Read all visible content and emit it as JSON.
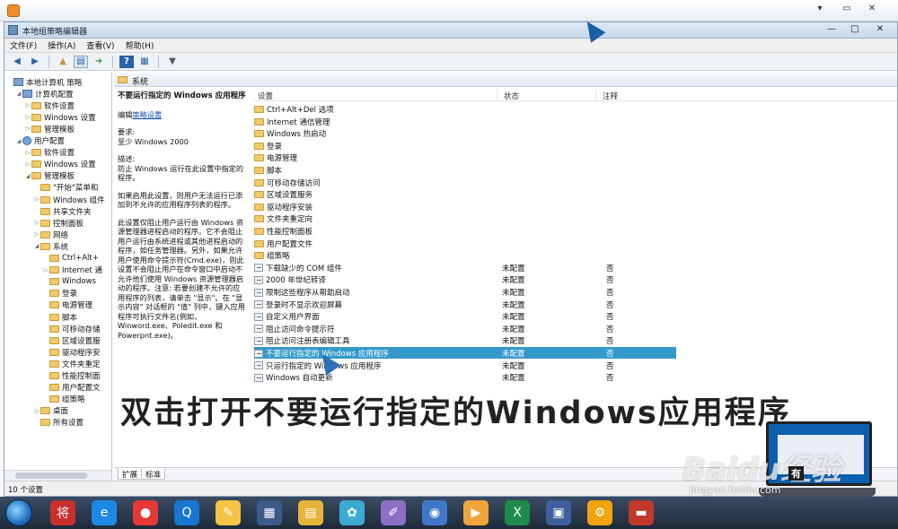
{
  "window": {
    "title": "本地组策略编辑器",
    "controls": [
      "—",
      "□",
      "✕"
    ]
  },
  "menu": [
    "文件(F)",
    "操作(A)",
    "查看(V)",
    "帮助(H)"
  ],
  "toolbar_icons": [
    "back-arrow-icon",
    "forward-arrow-icon",
    "up-folder-icon",
    "show-tree-icon",
    "export-list-icon",
    "help-icon",
    "properties-icon",
    "filter-icon"
  ],
  "tree": [
    {
      "label": "本地计算机 策略",
      "level": 0,
      "icon": "pc",
      "toggle": ""
    },
    {
      "label": "计算机配置",
      "level": 1,
      "icon": "pc",
      "toggle": "◢"
    },
    {
      "label": "软件设置",
      "level": 2,
      "icon": "fold",
      "toggle": "▷"
    },
    {
      "label": "Windows 设置",
      "level": 2,
      "icon": "fold",
      "toggle": "▷"
    },
    {
      "label": "管理模板",
      "level": 2,
      "icon": "fold",
      "toggle": "▷"
    },
    {
      "label": "用户配置",
      "level": 1,
      "icon": "usr",
      "toggle": "◢"
    },
    {
      "label": "软件设置",
      "level": 2,
      "icon": "fold",
      "toggle": "▷"
    },
    {
      "label": "Windows 设置",
      "level": 2,
      "icon": "fold",
      "toggle": "▷"
    },
    {
      "label": "管理模板",
      "level": 2,
      "icon": "fold",
      "toggle": "◢"
    },
    {
      "label": "\"开始\"菜单和",
      "level": 3,
      "icon": "fold",
      "toggle": ""
    },
    {
      "label": "Windows 组件",
      "level": 3,
      "icon": "fold",
      "toggle": "▷"
    },
    {
      "label": "共享文件夹",
      "level": 3,
      "icon": "fold",
      "toggle": ""
    },
    {
      "label": "控制面板",
      "level": 3,
      "icon": "fold",
      "toggle": "▷"
    },
    {
      "label": "网络",
      "level": 3,
      "icon": "fold",
      "toggle": "▷"
    },
    {
      "label": "系统",
      "level": 3,
      "icon": "fold",
      "toggle": "◢"
    },
    {
      "label": "Ctrl+Alt+",
      "level": 4,
      "icon": "fold",
      "toggle": ""
    },
    {
      "label": "Internet 通",
      "level": 4,
      "icon": "fold",
      "toggle": "▷"
    },
    {
      "label": "Windows",
      "level": 4,
      "icon": "fold",
      "toggle": ""
    },
    {
      "label": "登录",
      "level": 4,
      "icon": "fold",
      "toggle": ""
    },
    {
      "label": "电源管理",
      "level": 4,
      "icon": "fold",
      "toggle": ""
    },
    {
      "label": "脚本",
      "level": 4,
      "icon": "fold",
      "toggle": ""
    },
    {
      "label": "可移动存储",
      "level": 4,
      "icon": "fold",
      "toggle": ""
    },
    {
      "label": "区域设置服",
      "level": 4,
      "icon": "fold",
      "toggle": ""
    },
    {
      "label": "驱动程序安",
      "level": 4,
      "icon": "fold",
      "toggle": ""
    },
    {
      "label": "文件夹重定",
      "level": 4,
      "icon": "fold",
      "toggle": ""
    },
    {
      "label": "性能控制面",
      "level": 4,
      "icon": "fold",
      "toggle": ""
    },
    {
      "label": "用户配置文",
      "level": 4,
      "icon": "fold",
      "toggle": ""
    },
    {
      "label": "组策略",
      "level": 4,
      "icon": "fold",
      "toggle": ""
    },
    {
      "label": "桌面",
      "level": 3,
      "icon": "fold",
      "toggle": "▷"
    },
    {
      "label": "所有设置",
      "level": 3,
      "icon": "fold",
      "toggle": ""
    }
  ],
  "content_header": "系统",
  "description": {
    "title": "不要运行指定的 Windows 应用程序",
    "edit_prefix": "编辑",
    "edit_link": "策略设置",
    "req_label": "要求:",
    "req_value": "至少 Windows 2000",
    "desc_label": "描述:",
    "desc_1": "防止 Windows 运行在此设置中指定的程序。",
    "desc_2": "如果启用此设置，则用户无法运行已添加到不允许的应用程序列表的程序。",
    "desc_3": "此设置仅阻止用户运行由 Windows 资源管理器进程启动的程序。它不会阻止用户运行由系统进程或其他进程启动的程序，如任务管理器。另外，如果允许用户使用命令提示符(Cmd.exe)，则此设置不会阻止用户在命令窗口中启动不允许他们使用 Windows 资源管理器启动的程序。注意: 若要创建不允许的应用程序的列表，请单击 \"显示\"。在 \"显示内容\" 对话框的 \"值\" 列中，键入应用程序可执行文件名(例如，Winword.exe、Poledit.exe 和 Powerpnt.exe)。"
  },
  "columns": {
    "setting": "设置",
    "state": "状态",
    "comment": "注释"
  },
  "folders": [
    "Ctrl+Alt+Del 选项",
    "Internet 通信管理",
    "Windows 热启动",
    "登录",
    "电源管理",
    "脚本",
    "可移动存储访问",
    "区域设置服务",
    "驱动程序安装",
    "文件夹重定向",
    "性能控制面板",
    "用户配置文件",
    "组策略"
  ],
  "policies": [
    {
      "name": "下载缺少的 COM 组件",
      "state": "未配置",
      "comment": "否",
      "selected": false
    },
    {
      "name": "2000 年世纪转译",
      "state": "未配置",
      "comment": "否",
      "selected": false
    },
    {
      "name": "限制这些程序从帮助启动",
      "state": "未配置",
      "comment": "否",
      "selected": false
    },
    {
      "name": "登录时不显示欢迎屏幕",
      "state": "未配置",
      "comment": "否",
      "selected": false
    },
    {
      "name": "自定义用户界面",
      "state": "未配置",
      "comment": "否",
      "selected": false
    },
    {
      "name": "阻止访问命令提示符",
      "state": "未配置",
      "comment": "否",
      "selected": false
    },
    {
      "name": "阻止访问注册表编辑工具",
      "state": "未配置",
      "comment": "否",
      "selected": false
    },
    {
      "name": "不要运行指定的 Windows 应用程序",
      "state": "未配置",
      "comment": "否",
      "selected": true
    },
    {
      "name": "只运行指定的 Windows 应用程序",
      "state": "未配置",
      "comment": "否",
      "selected": false
    },
    {
      "name": "Windows 自动更新",
      "state": "未配置",
      "comment": "否",
      "selected": false
    }
  ],
  "tabs": [
    "扩展",
    "标准"
  ],
  "status": "10 个设置",
  "caption": "双击打开不要运行指定的Windows应用程序",
  "watermark": {
    "brand": "Baidu经验",
    "sub": "有",
    "url": "jingyan.baidu.com"
  },
  "taskbar": {
    "icons": [
      "start-orb-icon",
      "将-app-icon",
      "ie-browser-icon",
      "chrome-icon",
      "qq-icon",
      "notes-icon",
      "media-icon",
      "folder-icon",
      "pinwheel-icon",
      "paint-icon",
      "app-circle-icon",
      "player-icon",
      "excel-icon",
      "monitor-icon",
      "settings-gear-icon",
      "toolbox-icon"
    ],
    "labels": [
      "将",
      "e",
      "●",
      "Q",
      "✎",
      "▦",
      "▤",
      "✿",
      "✐",
      "◉",
      "▶",
      "X",
      "▣",
      "⚙",
      "▬"
    ],
    "colors": [
      "#c9302c",
      "#1e88e5",
      "#e53935",
      "#1976d2",
      "#f6c344",
      "#3d5a8a",
      "#e6b33b",
      "#3fa9d6",
      "#8e6fc7",
      "#3f78c8",
      "#f0a53a",
      "#1f8a4c",
      "#3f5fa0",
      "#f2a30f",
      "#c0392b"
    ]
  }
}
